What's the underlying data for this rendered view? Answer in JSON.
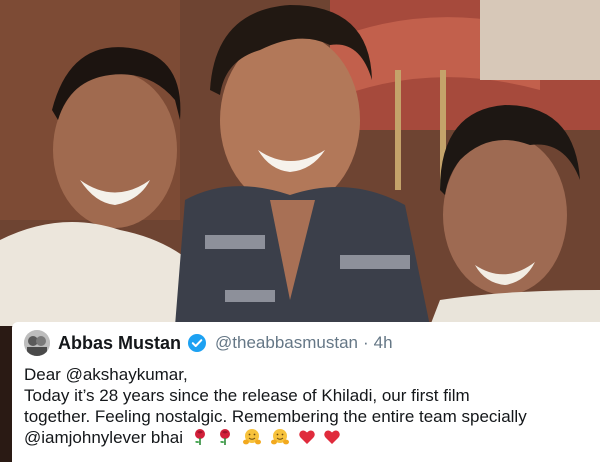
{
  "tweet": {
    "author_name": "Abbas Mustan",
    "handle": "@theabbasmustan",
    "separator": "·",
    "time": "4h",
    "verified": true,
    "lines": [
      "Dear @akshaykumar,",
      "Today it’s 28 years since the release of Khiladi, our first film",
      "together. Feeling nostalgic. Remembering the entire team specially",
      "@iamjohnylever bhai"
    ],
    "emojis": [
      "rose",
      "rose",
      "hugging-face",
      "hugging-face",
      "red-heart",
      "red-heart"
    ]
  },
  "colors": {
    "verified_badge": "#1da1f2",
    "muted_text": "#657786",
    "text": "#14171a"
  }
}
